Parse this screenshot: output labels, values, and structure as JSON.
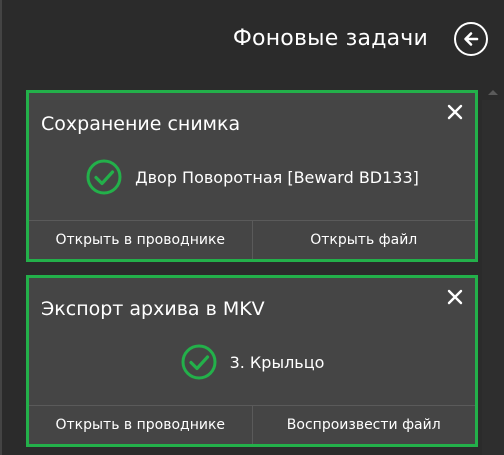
{
  "header": {
    "title": "Фоновые задачи",
    "back_icon": "arrow-left-circle-icon"
  },
  "accent_color": "#23b04a",
  "tasks": [
    {
      "title": "Сохранение снимка",
      "status_icon": "check-circle-icon",
      "status_text": "Двор Поворотная [Beward BD133]",
      "actions": [
        "Открыть в проводнике",
        "Открыть файл"
      ]
    },
    {
      "title": "Экспорт архива в MKV",
      "status_icon": "check-circle-icon",
      "status_text": "3. Крыльцо",
      "actions": [
        "Открыть в проводнике",
        "Воспроизвести файл"
      ]
    }
  ]
}
